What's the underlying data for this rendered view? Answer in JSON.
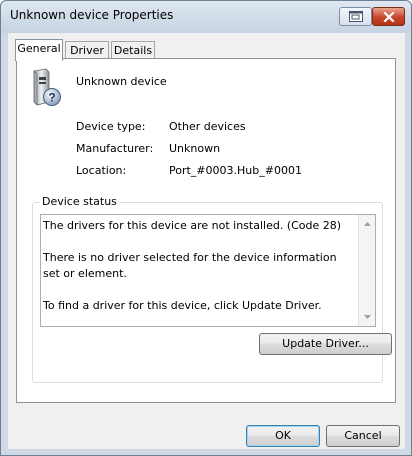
{
  "window": {
    "title": "Unknown device Properties",
    "help_icon": "help-icon",
    "close_icon": "close-icon"
  },
  "tabs": [
    {
      "label": "General",
      "active": true
    },
    {
      "label": "Driver",
      "active": false
    },
    {
      "label": "Details",
      "active": false
    }
  ],
  "device": {
    "icon": "unknown-device-icon",
    "name": "Unknown device",
    "properties": [
      {
        "label": "Device type:",
        "value": "Other devices"
      },
      {
        "label": "Manufacturer:",
        "value": "Unknown"
      },
      {
        "label": "Location:",
        "value": "Port_#0003.Hub_#0001"
      }
    ]
  },
  "status": {
    "group_title": "Device status",
    "text": "The drivers for this device are not installed. (Code 28)\n\nThere is no driver selected for the device information set or element.\n\nTo find a driver for this device, click Update Driver.",
    "update_button": "Update Driver..."
  },
  "footer": {
    "ok_label": "OK",
    "cancel_label": "Cancel"
  },
  "colors": {
    "accent_border": "#3c7fb1",
    "close_button": "#c7442a",
    "frame": "#cfd8e4"
  }
}
